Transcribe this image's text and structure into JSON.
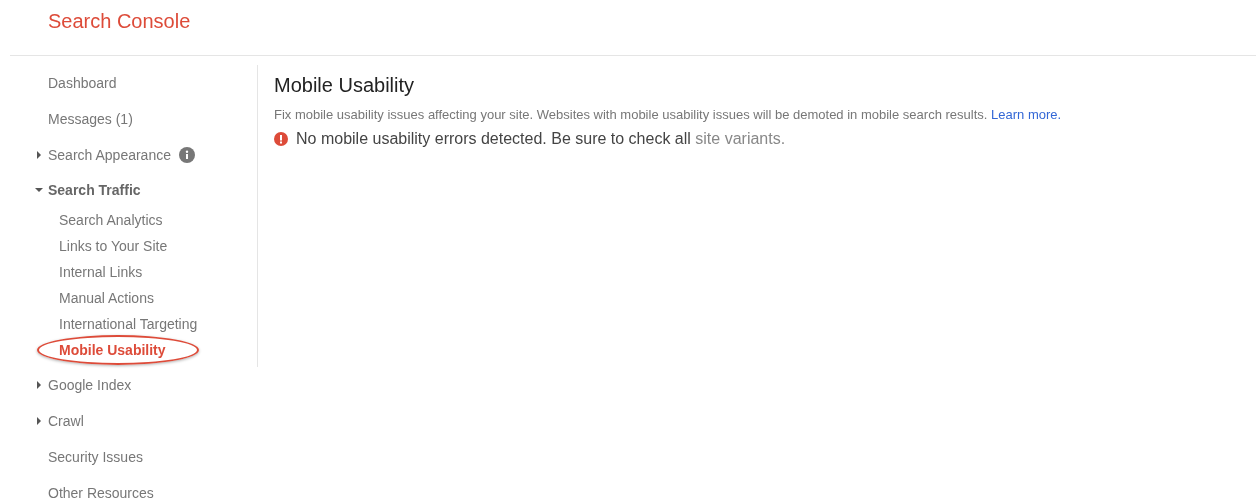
{
  "header": {
    "title": "Search Console"
  },
  "sidebar": {
    "items": [
      {
        "label": "Dashboard",
        "kind": "link",
        "selected": false
      },
      {
        "label": "Messages (1)",
        "kind": "link",
        "selected": false
      },
      {
        "label": "Search Appearance",
        "kind": "section",
        "expanded": false,
        "selected": false,
        "info_icon": true
      },
      {
        "label": "Search Traffic",
        "kind": "section",
        "expanded": true,
        "selected": false,
        "children": [
          {
            "label": "Search Analytics",
            "selected": false
          },
          {
            "label": "Links to Your Site",
            "selected": false
          },
          {
            "label": "Internal Links",
            "selected": false
          },
          {
            "label": "Manual Actions",
            "selected": false
          },
          {
            "label": "International Targeting",
            "selected": false
          },
          {
            "label": "Mobile Usability",
            "selected": true
          }
        ]
      },
      {
        "label": "Google Index",
        "kind": "section",
        "expanded": false,
        "selected": false
      },
      {
        "label": "Crawl",
        "kind": "section",
        "expanded": false,
        "selected": false
      },
      {
        "label": "Security Issues",
        "kind": "link",
        "selected": false
      },
      {
        "label": "Other Resources",
        "kind": "link",
        "selected": false
      }
    ]
  },
  "main": {
    "title": "Mobile Usability",
    "description": {
      "text": "Fix mobile usability issues affecting your site. Websites with mobile usability issues will be demoted in mobile search results.",
      "link": "Learn more."
    },
    "message": {
      "kind": "error",
      "text": "No mobile usability errors detected. Be sure to check all",
      "link": "site variants."
    }
  }
}
